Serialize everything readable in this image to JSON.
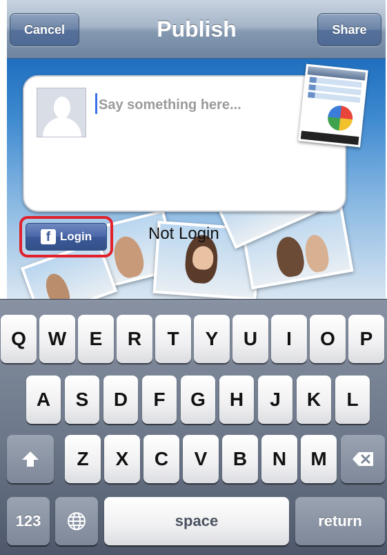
{
  "navbar": {
    "title": "Publish",
    "cancel_label": "Cancel",
    "share_label": "Share"
  },
  "compose": {
    "placeholder": "Say something here...",
    "value": "",
    "avatar_icon": "default-profile-silhouette",
    "attachment": "app-screenshot-thumbnail"
  },
  "facebook": {
    "icon": "facebook-f-icon",
    "login_label": "Login",
    "status": "Not Login"
  },
  "keyboard": {
    "row1": [
      "Q",
      "W",
      "E",
      "R",
      "T",
      "Y",
      "U",
      "I",
      "O",
      "P"
    ],
    "row2": [
      "A",
      "S",
      "D",
      "F",
      "G",
      "H",
      "J",
      "K",
      "L"
    ],
    "row3": [
      "Z",
      "X",
      "C",
      "V",
      "B",
      "N",
      "M"
    ],
    "numbers_label": "123",
    "space_label": "space",
    "return_label": "return",
    "shift_icon": "shift-arrow-icon",
    "globe_icon": "globe-icon",
    "delete_icon": "backspace-icon"
  },
  "colors": {
    "facebook_blue": "#3b5998",
    "highlight_red": "#e0202a",
    "cursor_blue": "#3a6ee8"
  }
}
